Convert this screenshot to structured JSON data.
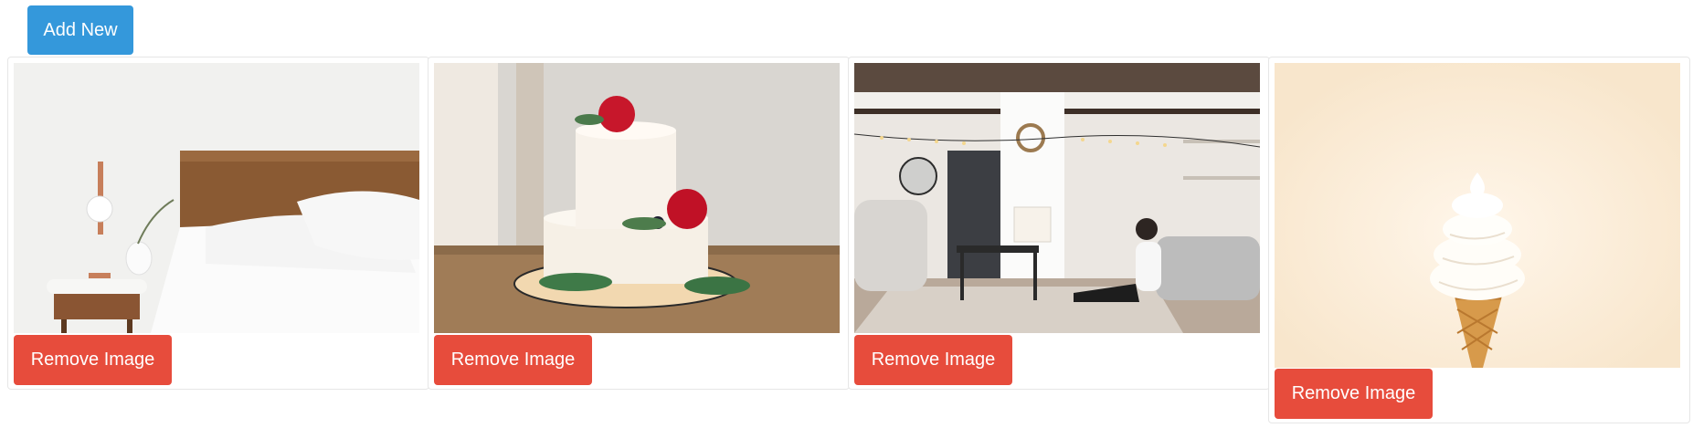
{
  "toolbar": {
    "add_label": "Add New"
  },
  "cards": [
    {
      "remove_label": "Remove Image",
      "image": "bedroom-photo"
    },
    {
      "remove_label": "Remove Image",
      "image": "wedding-cake-photo"
    },
    {
      "remove_label": "Remove Image",
      "image": "living-room-photo"
    },
    {
      "remove_label": "Remove Image",
      "image": "ice-cream-cone-photo"
    }
  ],
  "colors": {
    "primary": "#3498db",
    "danger": "#e74c3c"
  }
}
